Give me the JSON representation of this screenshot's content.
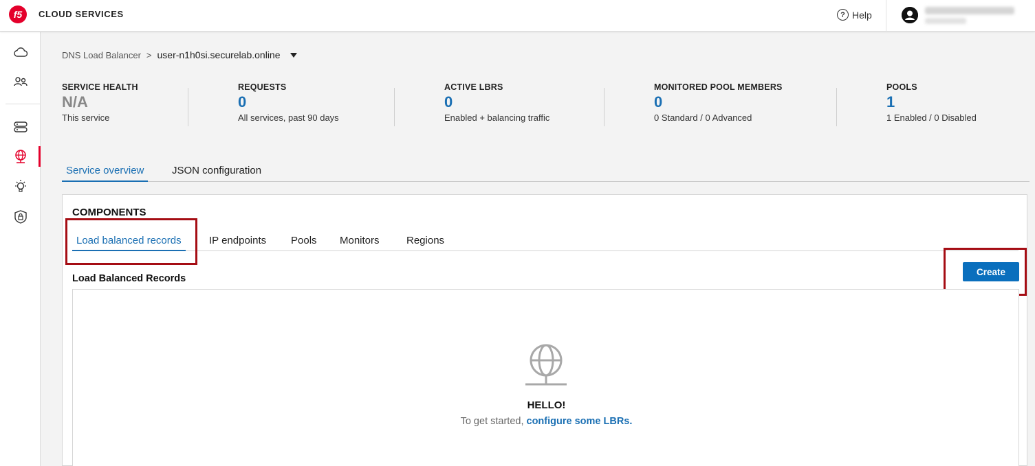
{
  "header": {
    "logo_text": "f5",
    "brand": "CLOUD SERVICES",
    "help_label": "Help",
    "help_icon": "question-circle-icon",
    "avatar_icon": "user-avatar-icon",
    "accent_color": "#e4002b"
  },
  "sidebar": {
    "items": [
      {
        "icon": "cloud-icon"
      },
      {
        "icon": "users-icon"
      },
      {
        "icon": "server-stack-icon"
      },
      {
        "icon": "globe-icon",
        "active": true
      },
      {
        "icon": "lightbulb-icon"
      },
      {
        "icon": "shield-lock-icon"
      }
    ]
  },
  "breadcrumb": {
    "root": "DNS Load Balancer",
    "separator": ">",
    "current": "user-n1h0si.securelab.online"
  },
  "stats": [
    {
      "label": "SERVICE HEALTH",
      "value": "N/A",
      "sub": "This service",
      "value_color": "#888888"
    },
    {
      "label": "REQUESTS",
      "value": "0",
      "sub": "All services, past 90 days",
      "value_color": "#1a6fb3"
    },
    {
      "label": "ACTIVE LBRS",
      "value": "0",
      "sub": "Enabled + balancing traffic",
      "value_color": "#1a6fb3"
    },
    {
      "label": "MONITORED POOL MEMBERS",
      "value": "0",
      "sub": "0 Standard / 0 Advanced",
      "value_color": "#1a6fb3"
    },
    {
      "label": "POOLS",
      "value": "1",
      "sub": "1 Enabled / 0 Disabled",
      "value_color": "#1a6fb3"
    }
  ],
  "main_tabs": [
    {
      "label": "Service overview",
      "active": true
    },
    {
      "label": "JSON configuration",
      "active": false
    }
  ],
  "components": {
    "title": "COMPONENTS",
    "tabs": [
      {
        "label": "Load balanced records",
        "active": true
      },
      {
        "label": "IP endpoints",
        "active": false
      },
      {
        "label": "Pools",
        "active": false
      },
      {
        "label": "Monitors",
        "active": false
      },
      {
        "label": "Regions",
        "active": false
      }
    ],
    "section_title": "Load Balanced Records",
    "create_label": "Create",
    "empty_state": {
      "icon": "globe-icon",
      "title": "HELLO!",
      "text": "To get started,",
      "link": "configure some LBRs."
    }
  },
  "colors": {
    "primary": "#1a6fb3",
    "button": "#0a6fbd",
    "highlight_box": "#a50d14"
  }
}
